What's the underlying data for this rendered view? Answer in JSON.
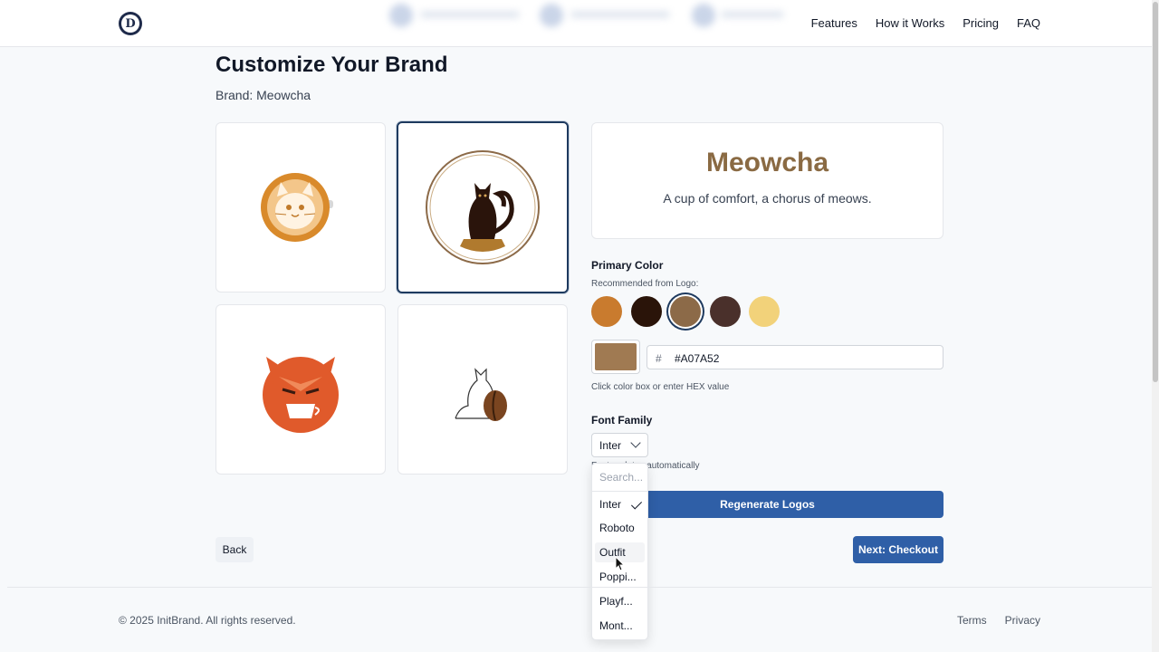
{
  "header": {
    "logo_letter": "D",
    "nav": [
      "Features",
      "How it Works",
      "Pricing",
      "FAQ"
    ]
  },
  "page": {
    "title": "Customize Your Brand",
    "brand_line": "Brand: Meowcha"
  },
  "logos": [
    {
      "name": "latte-cat-logo",
      "selected": false
    },
    {
      "name": "cat-cup-circle-logo",
      "selected": true
    },
    {
      "name": "orange-fox-cat-logo",
      "selected": false
    },
    {
      "name": "cat-coffee-bean-logo",
      "selected": false
    }
  ],
  "preview": {
    "brand_name": "Meowcha",
    "tagline": "A cup of comfort, a chorus of meows."
  },
  "primary_color": {
    "label": "Primary Color",
    "recommended_label": "Recommended from Logo:",
    "swatches": [
      "#C97B2E",
      "#2A1409",
      "#8C6A48",
      "#4A302B",
      "#F2D27A"
    ],
    "selected_index": 2,
    "hash_symbol": "#",
    "hex_value": "#A07A52",
    "hint": "Click color box or enter HEX value"
  },
  "font_family": {
    "label": "Font Family",
    "selected": "Inter",
    "hint": "Font updates automatically",
    "dropdown": {
      "search_placeholder": "Search...",
      "options": [
        "Inter",
        "Roboto",
        "Outfit",
        "Poppi...",
        "Playf...",
        "Mont..."
      ],
      "checked_index": 0,
      "hover_index": 2
    }
  },
  "buttons": {
    "regenerate": "Regenerate Logos",
    "back": "Back",
    "next": "Next: Checkout"
  },
  "footer": {
    "copyright": "© 2025 InitBrand. All rights reserved.",
    "links": [
      "Terms",
      "Privacy"
    ]
  }
}
